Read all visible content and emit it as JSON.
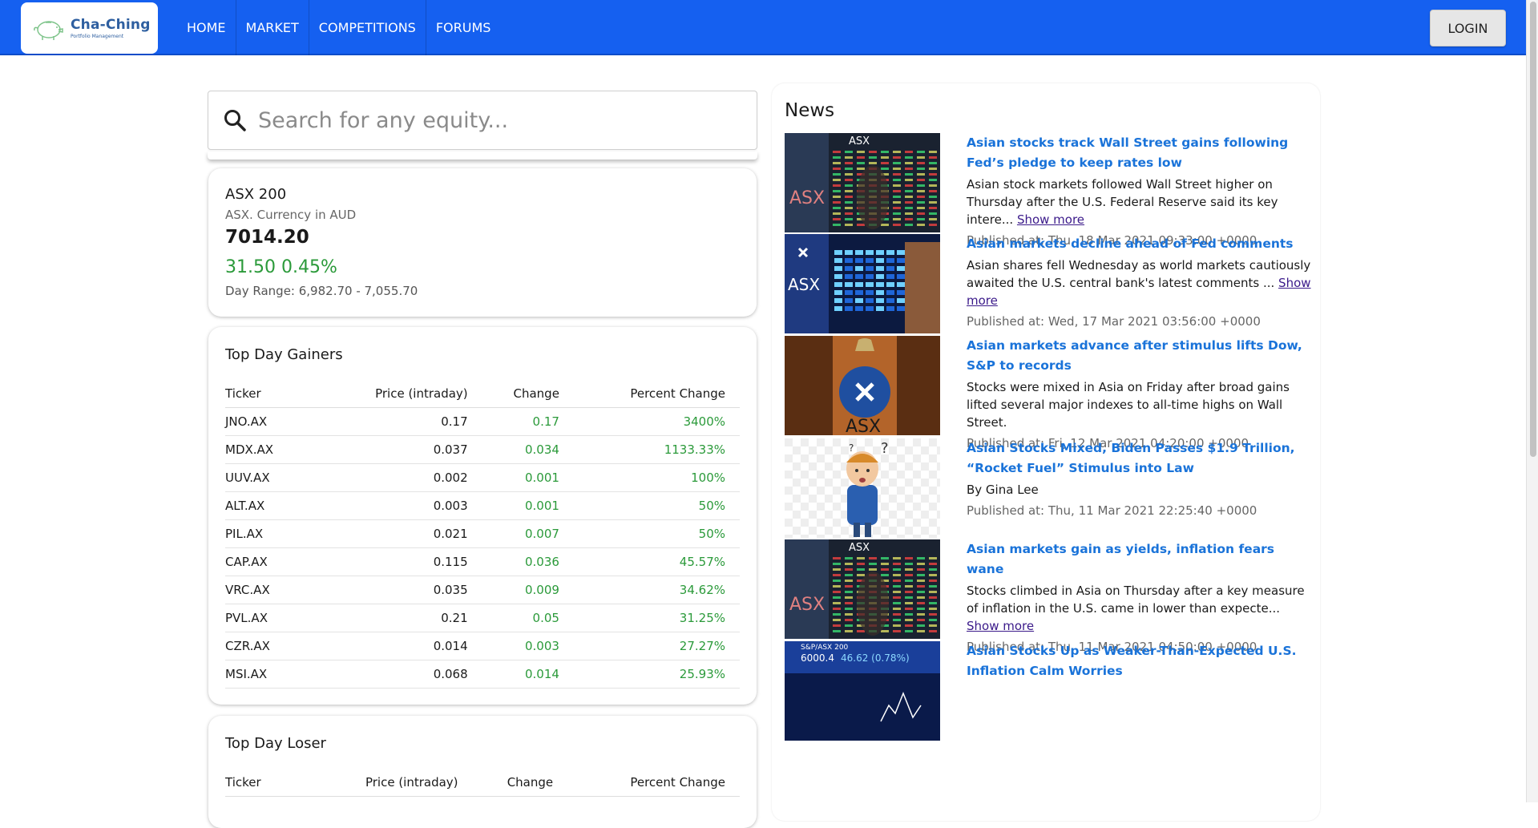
{
  "app": {
    "logo_title": "Cha-Ching",
    "logo_subtitle": "Portfolio Management"
  },
  "nav": {
    "items": [
      "HOME",
      "MARKET",
      "COMPETITIONS",
      "FORUMS"
    ],
    "login_label": "LOGIN"
  },
  "search": {
    "placeholder": "Search for any equity..."
  },
  "index": {
    "name": "ASX 200",
    "subtitle": "ASX. Currency in AUD",
    "price": "7014.20",
    "change": "31.50 0.45%",
    "day_range": "Day Range: 6,982.70 - 7,055.70"
  },
  "gainers": {
    "title": "Top Day Gainers",
    "columns": [
      "Ticker",
      "Price (intraday)",
      "Change",
      "Percent Change"
    ],
    "rows": [
      [
        "JNO.AX",
        "0.17",
        "0.17",
        "3400%"
      ],
      [
        "MDX.AX",
        "0.037",
        "0.034",
        "1133.33%"
      ],
      [
        "UUV.AX",
        "0.002",
        "0.001",
        "100%"
      ],
      [
        "ALT.AX",
        "0.003",
        "0.001",
        "50%"
      ],
      [
        "PIL.AX",
        "0.021",
        "0.007",
        "50%"
      ],
      [
        "CAP.AX",
        "0.115",
        "0.036",
        "45.57%"
      ],
      [
        "VRC.AX",
        "0.035",
        "0.009",
        "34.62%"
      ],
      [
        "PVL.AX",
        "0.21",
        "0.05",
        "31.25%"
      ],
      [
        "CZR.AX",
        "0.014",
        "0.003",
        "27.27%"
      ],
      [
        "MSI.AX",
        "0.068",
        "0.014",
        "25.93%"
      ]
    ]
  },
  "losers": {
    "title": "Top Day Loser",
    "columns": [
      "Ticker",
      "Price (intraday)",
      "Change",
      "Percent Change"
    ]
  },
  "news": {
    "title": "News",
    "show_more_label": "Show more",
    "items": [
      {
        "headline": "Asian stocks track Wall Street gains following Fed’s pledge to keep rates low",
        "desc": "Asian stock markets followed Wall Street higher on Thursday after the U.S. Federal Reserve said its key intere...",
        "show_more": true,
        "date": "Published at: Thu, 18 Mar 2021 09:33:00 +0000",
        "thumb": "asx-board"
      },
      {
        "headline": "Asian markets decline ahead of Fed comments",
        "desc": "Asian shares fell Wednesday as world markets cautiously awaited the U.S. central bank's latest comments ...",
        "show_more": true,
        "date": "Published at: Wed, 17 Mar 2021 03:56:00 +0000",
        "thumb": "asx-screens"
      },
      {
        "headline": "Asian markets advance after stimulus lifts Dow, S&P to records",
        "desc": "Stocks were mixed in Asia on Friday after broad gains lifted several major indexes to all-time highs on Wall Street.",
        "show_more": false,
        "date": "Published at: Fri, 12 Mar 2021 04:20:00 +0000",
        "thumb": "asx-bell"
      },
      {
        "headline": "Asian Stocks Mixed, Biden Passes $1.9 Trillion, “Rocket Fuel” Stimulus into Law",
        "desc": "By Gina Lee",
        "show_more": false,
        "date": "Published at: Thu, 11 Mar 2021 22:25:40 +0000",
        "thumb": "confused-man"
      },
      {
        "headline": "Asian markets gain as yields, inflation fears wane",
        "desc": "Stocks climbed in Asia on Thursday after a key measure of inflation in the U.S. came in lower than expecte...",
        "show_more": true,
        "date": "Published at: Thu, 11 Mar 2021 04:50:00 +0000",
        "thumb": "asx-board"
      },
      {
        "headline": "Asian Stocks Up as Weaker-Than-Expected U.S. Inflation Calm Worries",
        "desc": "",
        "show_more": false,
        "date": "",
        "thumb": "sp-asx-chart"
      }
    ]
  },
  "thumb_text": {
    "asx": "ASX",
    "sp_asx": "S&P/ASX 200",
    "sp_value": "6000.4",
    "sp_change": "46.62 (0.78%)"
  },
  "colors": {
    "navbar": "#1560f0",
    "positive": "#2b9a3a",
    "link": "#1a73d9",
    "show_more": "#3b1a8a"
  }
}
